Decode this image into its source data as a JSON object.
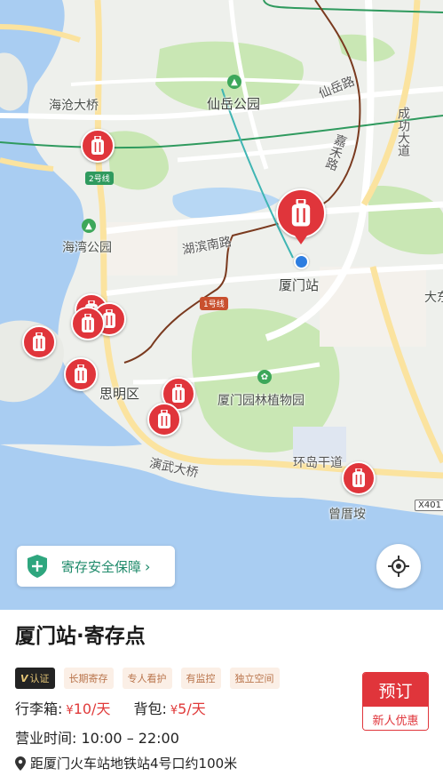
{
  "map": {
    "places": {
      "haicang_bridge": "海沧大桥",
      "xianyue_park": "仙岳公园",
      "xianyue_road": "仙岳路",
      "chenggong_ave": "成功大道",
      "jiahe_road": "嘉禾路",
      "hubin_south_road": "湖滨南路",
      "haiwan_park": "海湾公园",
      "xiamen_station": "厦门站",
      "siming_district": "思明区",
      "botanical_garden": "厦门园林植物园",
      "yanwu_bridge": "演武大桥",
      "huandao_road": "环岛干道",
      "zengcuoan": "曾厝垵",
      "dada_partial": "大东"
    },
    "metro_lines": {
      "line2": "2号线",
      "line1": "1号线"
    },
    "highway_badge": "X401",
    "colors": {
      "water": "#a9cdf2",
      "pin": "#e0353b",
      "green": "#c9e7b4",
      "metro2": "#2f9a5e",
      "metro1": "#7a3a1f"
    }
  },
  "safety_banner": {
    "label": "寄存安全保障",
    "chevron": "›"
  },
  "station": {
    "title": "厦门站·寄存点",
    "verified_label": "认证",
    "tags": [
      "长期寄存",
      "专人看护",
      "有监控",
      "独立空间"
    ],
    "luggage_label": "行李箱:",
    "luggage_price": "10",
    "backpack_label": "背包:",
    "backpack_price": "5",
    "currency": "¥",
    "unit": "/天",
    "hours_label": "营业时间:",
    "hours_value": "10:00 – 22:00",
    "distance": "距厦门火车站地铁站4号口约100米"
  },
  "booking": {
    "label": "预订",
    "sub_label": "新人优惠"
  }
}
